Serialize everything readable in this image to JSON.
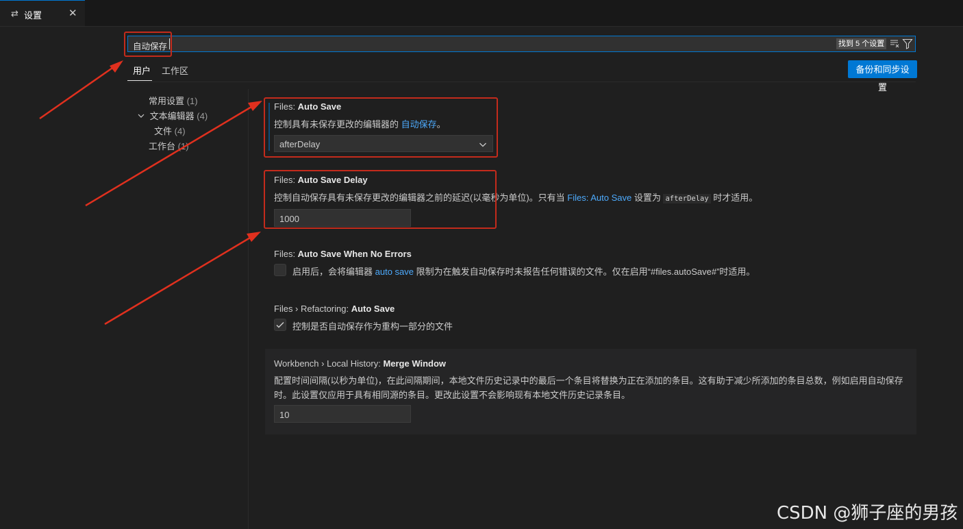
{
  "tab": {
    "icon": "settings-sliders-icon",
    "label": "设置",
    "close_label": "✕"
  },
  "search": {
    "value": "自动保存",
    "result_count": "找到 5 个设置",
    "clear_icon": "clear-filter-icon",
    "filter_icon": "filter-icon"
  },
  "scopes": {
    "user": "用户",
    "workspace": "工作区"
  },
  "sync_button": "备份和同步设置",
  "toc": [
    {
      "label": "常用设置",
      "count": "(1)"
    },
    {
      "label": "文本编辑器",
      "count": "(4)",
      "expanded": true
    },
    {
      "label": "文件",
      "count": "(4)"
    },
    {
      "label": "工作台",
      "count": "(1)"
    }
  ],
  "settings": [
    {
      "category": "Files: ",
      "name": "Auto Save",
      "desc_pre": "控制具有未保存更改的编辑器的 ",
      "desc_link": "自动保存",
      "desc_post": "。",
      "value": "afterDelay"
    },
    {
      "category": "Files: ",
      "name": "Auto Save Delay",
      "desc_pre": "控制自动保存具有未保存更改的编辑器之前的延迟(以毫秒为单位)。只有当 ",
      "desc_link": "Files: Auto Save",
      "desc_mid": " 设置为 ",
      "desc_code": "afterDelay",
      "desc_post": " 时才适用。",
      "value": "1000"
    },
    {
      "category": "Files: ",
      "name": "Auto Save When No Errors",
      "desc_pre": "启用后，会将编辑器 ",
      "desc_link": "auto save",
      "desc_post": " 限制为在触发自动保存时未报告任何错误的文件。仅在启用“#files.autoSave#”时适用。",
      "checked": false
    },
    {
      "category": "Files › Refactoring: ",
      "name": "Auto Save",
      "desc": "控制是否自动保存作为重构一部分的文件",
      "checked": true
    },
    {
      "category": "Workbench › Local History: ",
      "name": "Merge Window",
      "desc_line1": "配置时间间隔(以秒为单位)，在此间隔期间，本地文件历史记录中的最后一个条目将替换为正在添加的条目。这有助于减少所添加的条目总数，例如启用自动保存",
      "desc_line2": "时。此设置仅应用于具有相同源的条目。更改此设置不会影响现有本地文件历史记录条目。",
      "value": "10"
    }
  ],
  "watermark": "CSDN @狮子座的男孩",
  "colors": {
    "accent": "#0078d4",
    "link": "#4daafc",
    "annotation": "#c42b1c",
    "background": "#1f1f1f"
  }
}
